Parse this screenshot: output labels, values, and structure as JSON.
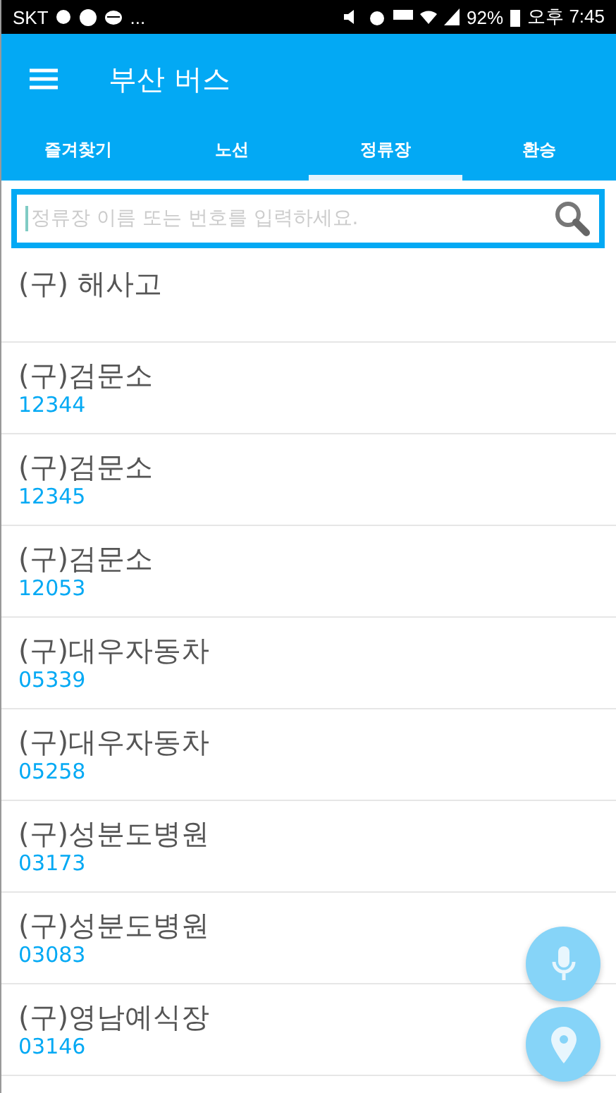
{
  "status_bar": {
    "carrier": "SKT",
    "more": "...",
    "battery": "92%",
    "time": "오후 7:45"
  },
  "app_bar": {
    "title": "부산 버스"
  },
  "tabs": [
    {
      "label": "즐겨찾기",
      "selected": false
    },
    {
      "label": "노선",
      "selected": false
    },
    {
      "label": "정류장",
      "selected": true
    },
    {
      "label": "환승",
      "selected": false
    }
  ],
  "search": {
    "placeholder": "정류장 이름 또는 번호를 입력하세요."
  },
  "stops": [
    {
      "name": "(구) 해사고"
    },
    {
      "name": "(구)검문소",
      "number": "12344"
    },
    {
      "name": "(구)검문소",
      "number": "12345"
    },
    {
      "name": "(구)검문소",
      "number": "12053"
    },
    {
      "name": "(구)대우자동차",
      "number": "05339"
    },
    {
      "name": "(구)대우자동차",
      "number": "05258"
    },
    {
      "name": "(구)성분도병원",
      "number": "03173"
    },
    {
      "name": "(구)성분도병원",
      "number": "03083"
    },
    {
      "name": "(구)영남예식장",
      "number": "03146"
    }
  ]
}
